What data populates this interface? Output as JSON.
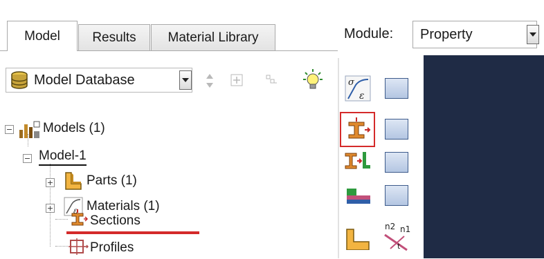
{
  "tabs": [
    {
      "label": "Model",
      "active": true
    },
    {
      "label": "Results",
      "active": false
    },
    {
      "label": "Material Library",
      "active": false
    }
  ],
  "module": {
    "label": "Module:",
    "value": "Property"
  },
  "database": {
    "value": "Model Database"
  },
  "tree": {
    "root": {
      "label": "Models (1)"
    },
    "model": {
      "label": "Model-1"
    },
    "items": [
      {
        "label": "Parts (1)",
        "icon": "parts-icon"
      },
      {
        "label": "Materials (1)",
        "icon": "materials-icon"
      },
      {
        "label": "Sections",
        "icon": "sections-icon"
      },
      {
        "label": "Profiles",
        "icon": "profiles-icon"
      }
    ]
  },
  "toolbox": {
    "icons": [
      "create-material-icon",
      "material-manager-icon",
      "create-section-icon",
      "section-manager-icon",
      "assign-section-icon",
      "section-assignment-manager-icon",
      "create-composite-layup-icon",
      "composite-layup-manager-icon",
      "assign-beam-orientation-icon",
      "assign-material-orientation-icon"
    ]
  },
  "colors": {
    "highlight_red": "#d42a2a",
    "viewport_bg": "#1f2b45",
    "tab_border": "#a9a9a9"
  }
}
